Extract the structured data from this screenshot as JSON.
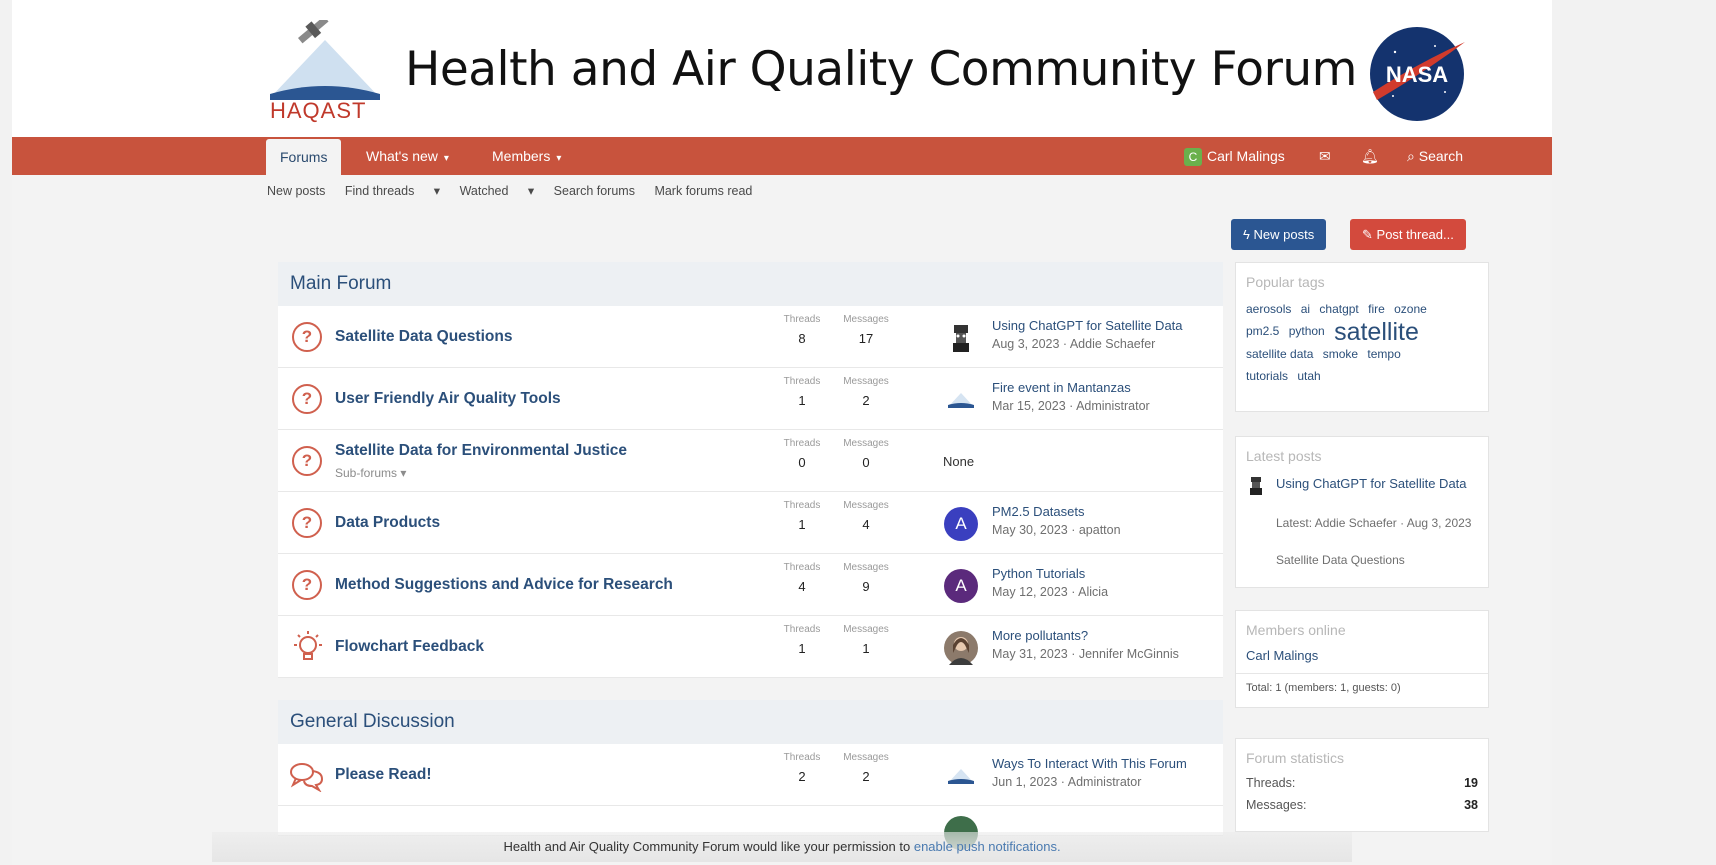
{
  "header": {
    "haqast_logo_text": "HAQAST",
    "site_title": "Health and Air Quality Community Forum",
    "nasa_logo_text": "NASA"
  },
  "nav": {
    "tabs": [
      {
        "label": "Forums",
        "active": true
      },
      {
        "label": "What's new"
      },
      {
        "label": "Members"
      }
    ],
    "user_initial": "C",
    "user_name": "Carl Malings",
    "search_label": "Search"
  },
  "subnav": [
    "New posts",
    "Find threads",
    "Watched",
    "Search forums",
    "Mark forums read"
  ],
  "buttons": {
    "new_posts": "New posts",
    "post_thread": "Post thread..."
  },
  "stat_labels": {
    "threads": "Threads",
    "messages": "Messages"
  },
  "sections": [
    {
      "title": "Main Forum",
      "forums": [
        {
          "title": "Satellite Data Questions",
          "threads": "8",
          "messages": "17",
          "last_title": "Using ChatGPT for Satellite Data",
          "last_meta": "Aug 3, 2023 · Addie Schaefer",
          "icon": "question-icon"
        },
        {
          "title": "User Friendly Air Quality Tools",
          "threads": "1",
          "messages": "2",
          "last_title": "Fire event in Mantanzas",
          "last_meta": "Mar 15, 2023 · Administrator",
          "icon": "question-icon"
        },
        {
          "title": "Satellite Data for Environmental Justice",
          "sub": "Sub-forums",
          "threads": "0",
          "messages": "0",
          "none": "None",
          "icon": "question-icon"
        },
        {
          "title": "Data Products",
          "threads": "1",
          "messages": "4",
          "last_title": "PM2.5 Datasets",
          "last_meta": "May 30, 2023 · apatton",
          "avatar": "A",
          "avatar_color": "#3a3fbf",
          "icon": "question-icon"
        },
        {
          "title": "Method Suggestions and Advice for Research",
          "threads": "4",
          "messages": "9",
          "last_title": "Python Tutorials",
          "last_meta": "May 12, 2023 · Alicia",
          "avatar": "A",
          "avatar_color": "#5b2a7c",
          "icon": "question-icon"
        },
        {
          "title": "Flowchart Feedback",
          "threads": "1",
          "messages": "1",
          "last_title": "More pollutants?",
          "last_meta": "May 31, 2023 · Jennifer McGinnis",
          "icon": "lightbulb-icon"
        }
      ]
    },
    {
      "title": "General Discussion",
      "forums": [
        {
          "title": "Please Read!",
          "threads": "2",
          "messages": "2",
          "last_title": "Ways To Interact With This Forum",
          "last_meta": "Jun 1, 2023 · Administrator",
          "icon": "chat-bubbles-icon"
        }
      ]
    }
  ],
  "sidebar": {
    "popular_tags": {
      "title": "Popular tags",
      "tags": [
        "aerosols",
        "ai",
        "chatgpt",
        "fire",
        "ozone",
        "pm2.5",
        "python",
        "satellite",
        "satellite data",
        "smoke",
        "tempo",
        "tutorials",
        "utah"
      ]
    },
    "latest_posts": {
      "title": "Latest posts",
      "post_title": "Using ChatGPT for Satellite Data",
      "post_meta": "Latest: Addie Schaefer · Aug 3, 2023",
      "post_forum": "Satellite Data Questions"
    },
    "members_online": {
      "title": "Members online",
      "member": "Carl Malings",
      "total": "Total: 1 (members: 1, guests: 0)"
    },
    "forum_statistics": {
      "title": "Forum statistics",
      "threads_label": "Threads:",
      "threads_value": "19",
      "messages_label": "Messages:",
      "messages_value": "38"
    }
  },
  "push_notice": {
    "text": "Health and Air Quality Community Forum would like your permission to",
    "link": "enable push notifications."
  }
}
